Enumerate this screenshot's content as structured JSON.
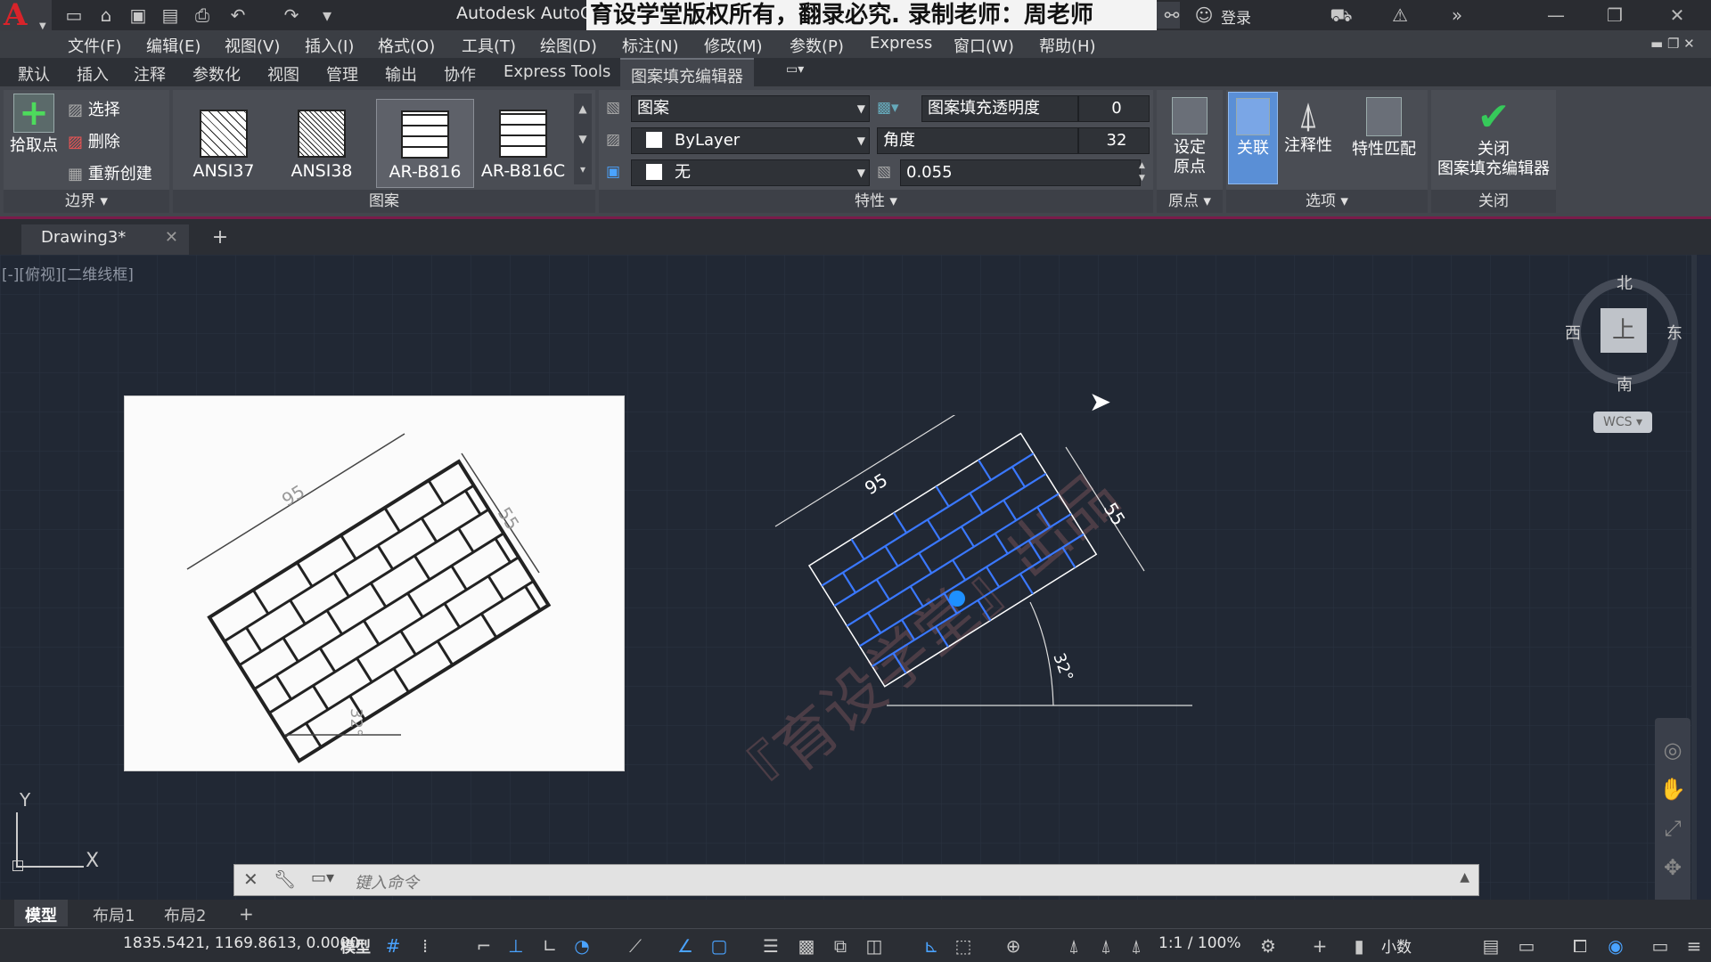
{
  "title_bar": {
    "app_title": "Autodesk AutoC",
    "banner": "育设学堂版权所有，翻录必究. 录制老师：周老师",
    "login": "登录",
    "quick_access_icons": [
      "new-icon",
      "open-icon",
      "save-icon",
      "saveas-icon",
      "print-icon",
      "undo-icon",
      "redo-icon"
    ]
  },
  "menu": [
    "文件(F)",
    "编辑(E)",
    "视图(V)",
    "插入(I)",
    "格式(O)",
    "工具(T)",
    "绘图(D)",
    "标注(N)",
    "修改(M)",
    "参数(P)",
    "Express",
    "窗口(W)",
    "帮助(H)"
  ],
  "ribbon_tabs": {
    "items": [
      "默认",
      "插入",
      "注释",
      "参数化",
      "视图",
      "管理",
      "输出",
      "协作",
      "Express Tools"
    ],
    "active": "图案填充编辑器"
  },
  "ribbon": {
    "boundary": {
      "pick_points": "拾取点",
      "select": "选择",
      "remove": "删除",
      "recreate": "重新创建",
      "label": "边界"
    },
    "pattern": {
      "items": [
        "ANSI37",
        "ANSI38",
        "AR-B816",
        "AR-B816C"
      ],
      "selected": "AR-B816",
      "label": "图案"
    },
    "properties": {
      "type": "图案",
      "color": "ByLayer",
      "background": "无",
      "transparency_label": "图案填充透明度",
      "transparency_value": "0",
      "angle_label": "角度",
      "angle_value": "32",
      "scale_value": "0.055",
      "label": "特性"
    },
    "origin": {
      "set_origin_line1": "设定",
      "set_origin_line2": "原点",
      "label": "原点"
    },
    "options": {
      "associative": "关联",
      "annotative": "注释性",
      "match": "特性匹配",
      "label": "选项"
    },
    "close": {
      "line1": "关闭",
      "line2": "图案填充编辑器",
      "label": "关闭"
    }
  },
  "file_tab": {
    "name": "Drawing3*"
  },
  "canvas": {
    "viewport_label": "[-][俯视][二维线框]",
    "ref_dims": {
      "length": "95",
      "width": "55",
      "angle": "32°"
    },
    "drawing_dims": {
      "length": "95",
      "width": "55",
      "angle": "32°"
    },
    "watermark": "『育设学堂』出品",
    "viewcube": {
      "north": "北",
      "south": "南",
      "east": "东",
      "west": "西",
      "top": "上",
      "wcs": "WCS"
    },
    "ucs": {
      "y": "Y",
      "x": "X"
    },
    "command_placeholder": "键入命令"
  },
  "layout_tabs": {
    "items": [
      "模型",
      "布局1",
      "布局2"
    ],
    "active": "模型"
  },
  "status_bar": {
    "coords": "1835.5421, 1169.8613, 0.0000",
    "model": "模型",
    "scale": "1:1 / 100%",
    "units": "小数"
  },
  "colors": {
    "hatch": "#3a78ff",
    "grip": "#1e90ff",
    "accent": "#7a1b4a",
    "check": "#36c95a"
  }
}
